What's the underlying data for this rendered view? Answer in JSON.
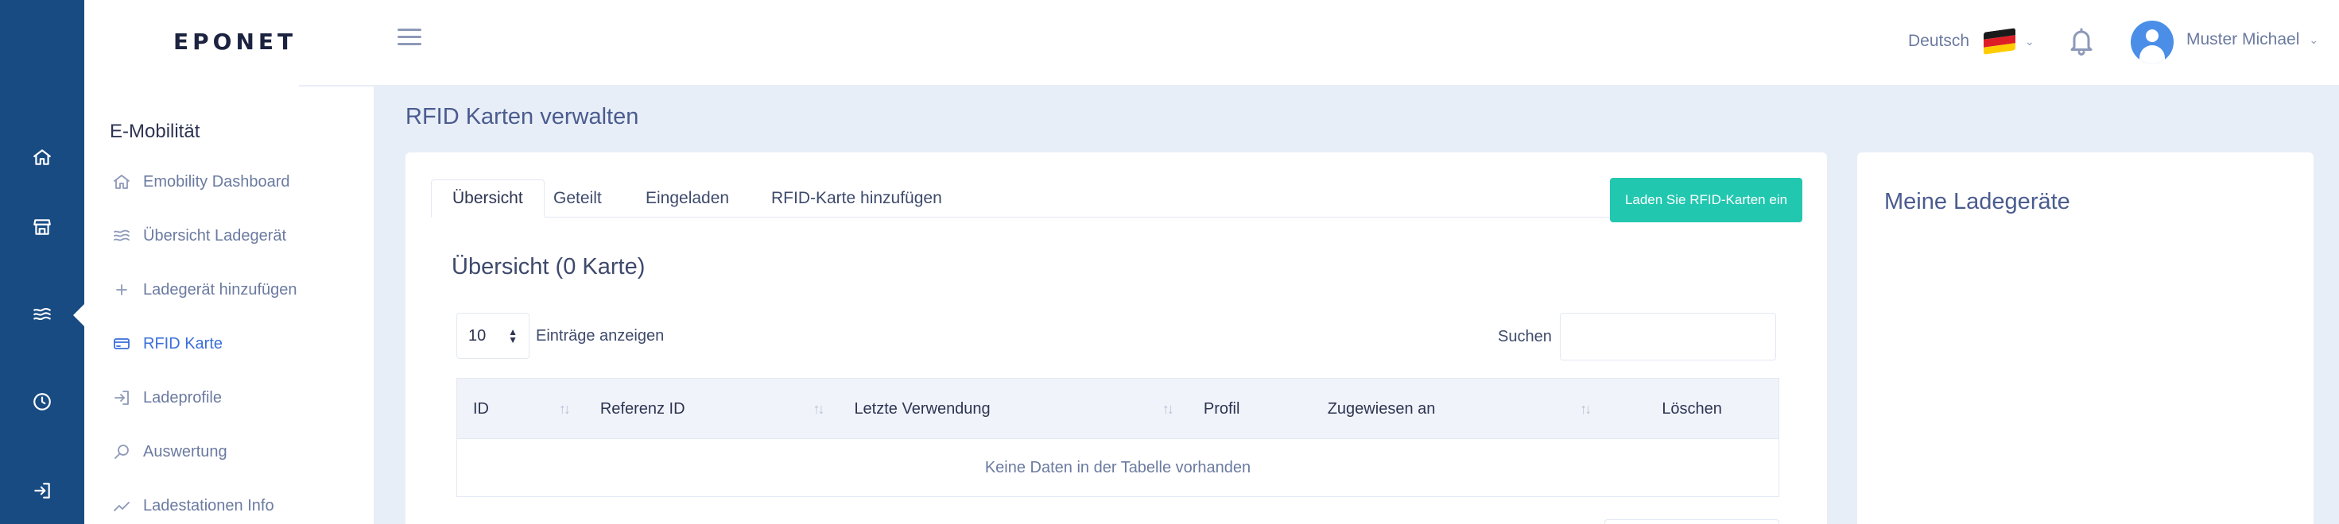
{
  "app": {
    "logo_text": "EPONET"
  },
  "rail": {
    "items": [
      {
        "icon": "home-icon"
      },
      {
        "icon": "store-icon"
      },
      {
        "icon": "waves-icon"
      },
      {
        "icon": "clock-icon"
      },
      {
        "icon": "logout-icon"
      }
    ]
  },
  "sidebar": {
    "section_title": "E-Mobilität",
    "items": [
      {
        "label": "Emobility Dashboard",
        "icon": "home-icon"
      },
      {
        "label": "Übersicht Ladegerät",
        "icon": "waves-icon"
      },
      {
        "label": "Ladegerät hinzufügen",
        "icon": "plus-icon"
      },
      {
        "label": "RFID Karte",
        "icon": "card-icon",
        "active": true
      },
      {
        "label": "Ladeprofile",
        "icon": "login-icon"
      },
      {
        "label": "Auswertung",
        "icon": "search-icon"
      },
      {
        "label": "Ladestationen Info",
        "icon": "trend-icon"
      }
    ]
  },
  "header": {
    "language": "Deutsch",
    "user_name": "Muster Michael"
  },
  "page": {
    "title": "RFID Karten verwalten"
  },
  "tabs": [
    {
      "label": "Übersicht",
      "active": true
    },
    {
      "label": "Geteilt"
    },
    {
      "label": "Eingeladen"
    },
    {
      "label": "RFID-Karte hinzufügen"
    }
  ],
  "actions": {
    "load_button": "Laden Sie RFID-Karten ein"
  },
  "overview": {
    "title": "Übersicht (0 Karte)",
    "page_length": "10",
    "page_length_label": "Einträge anzeigen",
    "search_label": "Suchen",
    "search_value": ""
  },
  "table": {
    "columns": [
      "ID",
      "Referenz ID",
      "Letzte Verwendung",
      "Profil",
      "Zugewiesen an",
      "Löschen"
    ],
    "empty_message": "Keine Daten in der Tabelle vorhanden"
  },
  "side_card": {
    "title": "Meine Ladegeräte"
  },
  "colors": {
    "rail": "#184b82",
    "accent": "#22c7b0",
    "active_link": "#3b6fd9",
    "background": "#e8eef7"
  }
}
